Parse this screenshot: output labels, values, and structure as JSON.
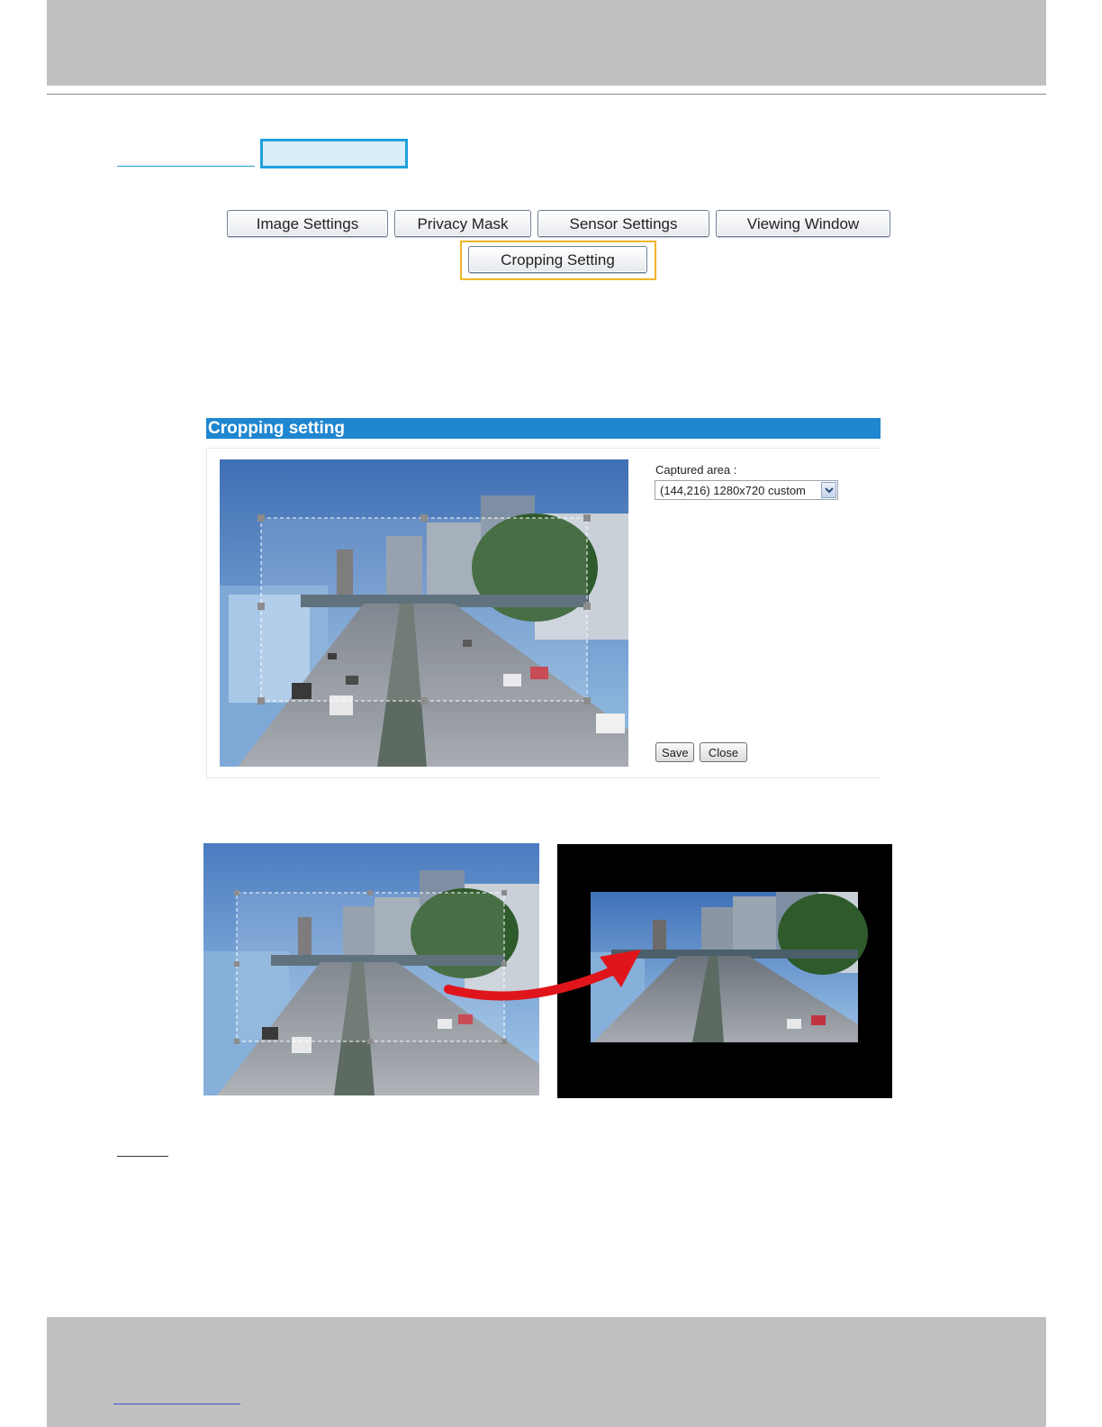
{
  "tabs": {
    "image_settings": "Image Settings",
    "privacy_mask": "Privacy Mask",
    "sensor_settings": "Sensor Settings",
    "viewing_window": "Viewing Window",
    "cropping_setting": "Cropping Setting"
  },
  "panel": {
    "title": "Cropping setting",
    "captured_area_label": "Captured area :",
    "captured_area_value": "(144,216) 1280x720 custom",
    "save_label": "Save",
    "close_label": "Close"
  },
  "colors": {
    "panel_bar": "#1f86d0",
    "highlight": "#f0b429",
    "title_box": "#1fa0dc",
    "arrow": "#e0151b"
  }
}
